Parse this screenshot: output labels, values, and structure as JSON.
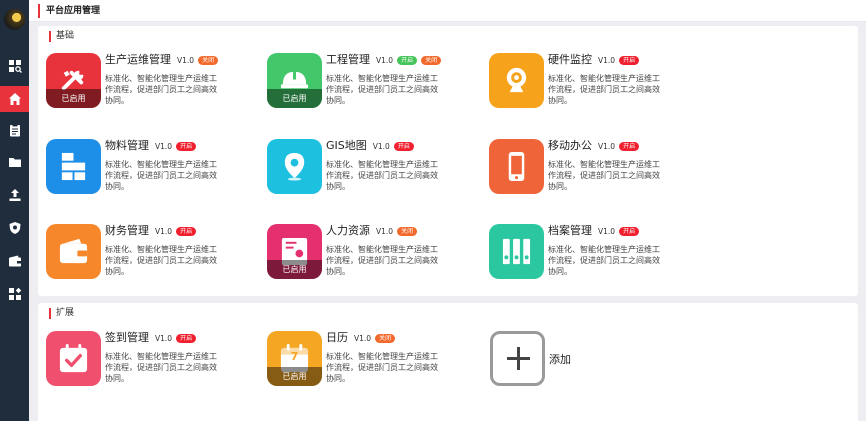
{
  "page": {
    "title": "平台应用管理"
  },
  "sidebar": {
    "items": [
      {
        "icon": "grid-search-icon"
      },
      {
        "icon": "home-icon",
        "active": true
      },
      {
        "icon": "clipboard-icon"
      },
      {
        "icon": "folder-icon"
      },
      {
        "icon": "upload-icon"
      },
      {
        "icon": "shield-icon"
      },
      {
        "icon": "wallet-icon"
      },
      {
        "icon": "apps-icon"
      }
    ]
  },
  "sections": [
    {
      "title": "基础",
      "apps": [
        {
          "name": "生产运维管理",
          "version": "V1.0",
          "badges": [
            {
              "text": "关闭",
              "color": "#f2692b"
            }
          ],
          "desc": "标准化、智能化管理生产运维工作流程，促进部门员工之间高效协同。",
          "overlay": "已启用",
          "icon": "wrench-icon",
          "bg": "#e8323c"
        },
        {
          "name": "工程管理",
          "version": "V1.0",
          "badges": [
            {
              "text": "开启",
              "color": "#45c45a"
            },
            {
              "text": "关闭",
              "color": "#f2692b"
            }
          ],
          "desc": "标准化、智能化管理生产运维工作流程，促进部门员工之间高效协同。",
          "overlay": "已启用",
          "icon": "helmet-icon",
          "bg": "#42c86a"
        },
        {
          "name": "硬件监控",
          "version": "V1.0",
          "badges": [
            {
              "text": "开启",
              "color": "#f0202e"
            }
          ],
          "desc": "标准化、智能化管理生产运维工作流程，促进部门员工之间高效协同。",
          "overlay": "",
          "icon": "webcam-icon",
          "bg": "#f7a21b"
        },
        {
          "name": "物料管理",
          "version": "V1.0",
          "badges": [
            {
              "text": "开启",
              "color": "#f0202e"
            }
          ],
          "desc": "标准化、智能化管理生产运维工作流程，促进部门员工之间高效协同。",
          "overlay": "",
          "icon": "boxes-icon",
          "bg": "#1e8fe8"
        },
        {
          "name": "GIS地图",
          "version": "V1.0",
          "badges": [
            {
              "text": "开启",
              "color": "#f0202e"
            }
          ],
          "desc": "标准化、智能化管理生产运维工作流程，促进部门员工之间高效协同。",
          "overlay": "",
          "icon": "map-pin-icon",
          "bg": "#1ec0e0"
        },
        {
          "name": "移动办公",
          "version": "V1.0",
          "badges": [
            {
              "text": "开启",
              "color": "#f0202e"
            }
          ],
          "desc": "标准化、智能化管理生产运维工作流程，促进部门员工之间高效协同。",
          "overlay": "",
          "icon": "phone-icon",
          "bg": "#f0643a"
        },
        {
          "name": "财务管理",
          "version": "V1.0",
          "badges": [
            {
              "text": "开启",
              "color": "#f0202e"
            }
          ],
          "desc": "标准化、智能化管理生产运维工作流程，促进部门员工之间高效协同。",
          "overlay": "",
          "icon": "wallet-icon",
          "bg": "#f7872b"
        },
        {
          "name": "人力资源",
          "version": "V1.0",
          "badges": [
            {
              "text": "关闭",
              "color": "#f2692b"
            }
          ],
          "desc": "标准化、智能化管理生产运维工作流程，促进部门员工之间高效协同。",
          "overlay": "已启用",
          "icon": "id-card-icon",
          "bg": "#e4306e"
        },
        {
          "name": "档案管理",
          "version": "V1.0",
          "badges": [
            {
              "text": "开启",
              "color": "#f0202e"
            }
          ],
          "desc": "标准化、智能化管理生产运维工作流程，促进部门员工之间高效协同。",
          "overlay": "",
          "icon": "archive-icon",
          "bg": "#2bc7a0"
        }
      ]
    },
    {
      "title": "扩展",
      "apps": [
        {
          "name": "签到管理",
          "version": "V1.0",
          "badges": [
            {
              "text": "开启",
              "color": "#f0202e"
            }
          ],
          "desc": "标准化、智能化管理生产运维工作流程，促进部门员工之间高效协同。",
          "overlay": "",
          "icon": "calendar-check-icon",
          "bg": "#f0506e"
        },
        {
          "name": "日历",
          "version": "V1.0",
          "badges": [
            {
              "text": "关闭",
              "color": "#f2692b"
            }
          ],
          "desc": "标准化、智能化管理生产运维工作流程，促进部门员工之间高效协同。",
          "overlay": "已启用",
          "icon": "calendar-icon",
          "bg": "#f5a623",
          "day": "7"
        }
      ],
      "add_label": "添加"
    }
  ]
}
